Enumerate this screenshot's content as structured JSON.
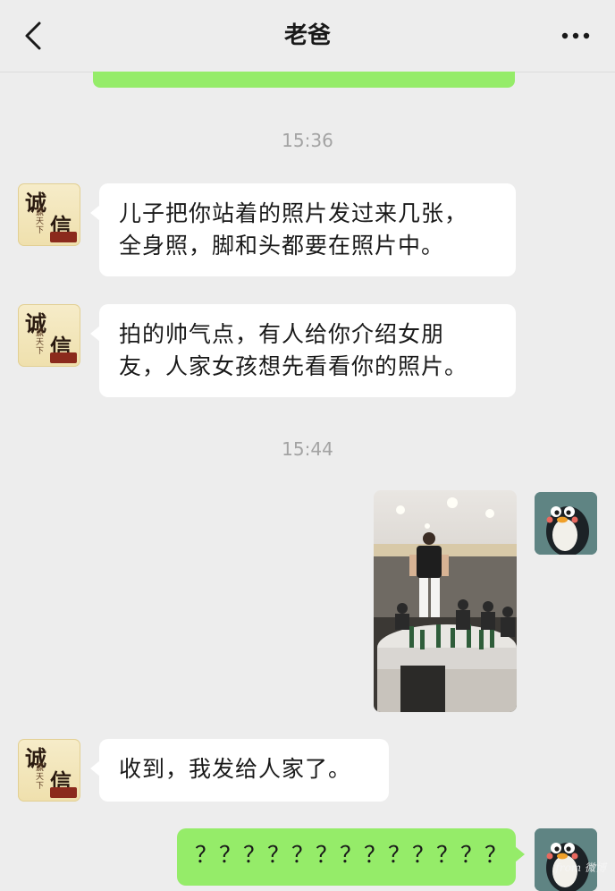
{
  "header": {
    "title": "老爸",
    "back_icon": "chevron-left-icon",
    "more_icon": "more-dots-icon"
  },
  "colors": {
    "background": "#ededed",
    "incoming_bubble": "#ffffff",
    "outgoing_bubble": "#95ec69",
    "timestamp": "#a3a3a3"
  },
  "messages": [
    {
      "type": "time",
      "text": "15:36"
    },
    {
      "type": "incoming",
      "sender": "dad",
      "lines": [
        "儿子把你站着的照片发过来几张，",
        "全身照，脚和头都要在照片中。"
      ]
    },
    {
      "type": "incoming",
      "sender": "dad",
      "lines": [
        "拍的帅气点，有人给你介绍女朋",
        "友，人家女孩想先看看你的照片。"
      ]
    },
    {
      "type": "time",
      "text": "15:44"
    },
    {
      "type": "outgoing-image",
      "sender": "me",
      "image": "banquet-table-standing-photo"
    },
    {
      "type": "incoming",
      "sender": "dad",
      "lines": [
        "收到，我发给人家了。"
      ]
    },
    {
      "type": "outgoing",
      "sender": "me",
      "lines": [
        "？？？？？？？？？？？？？？"
      ]
    }
  ],
  "avatars": {
    "dad": {
      "line1": "诚",
      "line2": "信",
      "small": "赢天下"
    },
    "me": {
      "icon": "penguin-avatar-icon"
    }
  },
  "watermark": "from 微博"
}
